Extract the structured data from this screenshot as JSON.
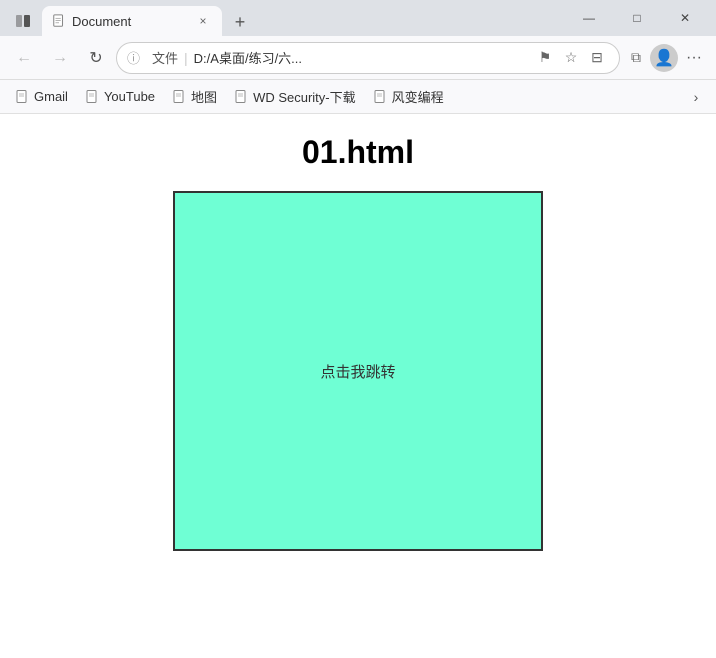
{
  "browser": {
    "tab": {
      "label": "Document",
      "close_icon": "×"
    },
    "new_tab_icon": "+",
    "window_controls": {
      "minimize": "—",
      "maximize": "□",
      "close": "✕"
    }
  },
  "nav": {
    "back_icon": "←",
    "forward_icon": "→",
    "refresh_icon": "↻",
    "address": {
      "info_text": "ⓘ",
      "file_label": "文件",
      "path": "D:/A桌面/练习/六...",
      "divider": "|"
    },
    "actions": {
      "star_badge": "⚑",
      "star": "☆",
      "collections": "⊟",
      "split_screen": "⧉"
    },
    "avatar_icon": "👤",
    "menu_icon": "···"
  },
  "bookmarks": {
    "items": [
      {
        "label": "Gmail",
        "icon": "📄"
      },
      {
        "label": "YouTube",
        "icon": "📄"
      },
      {
        "label": "地图",
        "icon": "📄"
      },
      {
        "label": "WD Security-下载",
        "icon": "📄"
      },
      {
        "label": "风变编程",
        "icon": "📄"
      }
    ],
    "arrow": "›"
  },
  "page": {
    "title": "01.html",
    "box_text": "点击我跳转"
  }
}
